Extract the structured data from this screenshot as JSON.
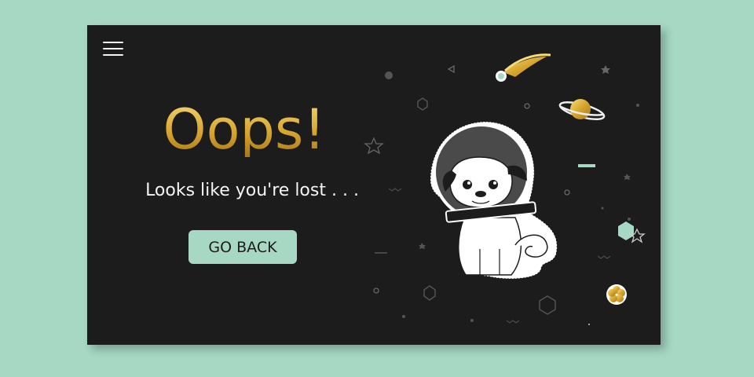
{
  "menu": {
    "icon": "hamburger-menu-icon"
  },
  "hero": {
    "title": "Oops!",
    "subtitle": "Looks like you're lost . . .",
    "button_label": "GO BACK"
  },
  "illustration": {
    "icons": [
      "pug-astronaut",
      "comet-icon",
      "planet-icon",
      "flower-icon",
      "star-icon",
      "hexagon-icon"
    ]
  },
  "colors": {
    "background": "#a6d8c3",
    "panel": "#1d1c1d",
    "gold": "#d4a630",
    "mint": "#a6d8c3",
    "text": "#f4f4f4"
  }
}
